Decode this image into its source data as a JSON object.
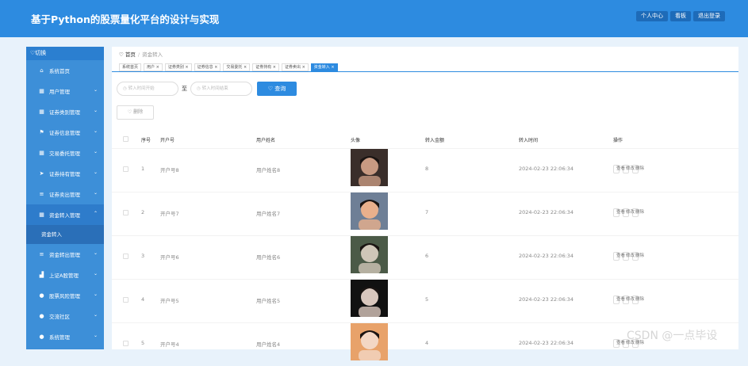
{
  "header": {
    "title": "基于Python的股票量化平台的设计与实现",
    "buttons": [
      "个人中心",
      "看板",
      "退出登录"
    ]
  },
  "sidebar": {
    "switch_label": "切换",
    "items": [
      {
        "label": "系统首页",
        "icon": "home-icon",
        "chevron": false
      },
      {
        "label": "用户管理",
        "icon": "grid-icon",
        "chevron": true
      },
      {
        "label": "证券类别管理",
        "icon": "grid-icon",
        "chevron": true
      },
      {
        "label": "证券信息管理",
        "icon": "flag-icon",
        "chevron": true
      },
      {
        "label": "交易委托管理",
        "icon": "grid-icon",
        "chevron": true
      },
      {
        "label": "证券持有管理",
        "icon": "send-icon",
        "chevron": true
      },
      {
        "label": "证券卖出管理",
        "icon": "list-icon",
        "chevron": true
      },
      {
        "label": "资金转入管理",
        "icon": "grid-icon",
        "chevron": true,
        "active": true
      },
      {
        "label": "资金转出管理",
        "icon": "list-icon",
        "chevron": true
      },
      {
        "label": "上证A股管理",
        "icon": "chart-icon",
        "chevron": true
      },
      {
        "label": "股票风险管理",
        "icon": "user-icon",
        "chevron": true
      },
      {
        "label": "交流社区",
        "icon": "pin-icon",
        "chevron": true
      },
      {
        "label": "系统管理",
        "icon": "user-icon",
        "chevron": true
      }
    ],
    "subitem": "资金转入"
  },
  "breadcrumb": {
    "home": "首页",
    "current": "资金转入"
  },
  "tabs": [
    "系统首页",
    "用户",
    "证券类别",
    "证券信息",
    "交易委托",
    "证券持有",
    "证券卖出",
    "资金转入"
  ],
  "search": {
    "start_placeholder": "转入时间开始",
    "to": "至",
    "end_placeholder": "转入时间结束",
    "button": "查询"
  },
  "delete_button": "删除",
  "table": {
    "headers": [
      "序号",
      "开户号",
      "用户姓名",
      "头像",
      "转入金额",
      "转入时间",
      "操作"
    ],
    "actions": [
      "查看",
      "修改",
      "删除"
    ],
    "rows": [
      {
        "no": "1",
        "account": "开户号8",
        "name": "用户姓名8",
        "amount": "8",
        "time": "2024-02-23 22:06:34"
      },
      {
        "no": "2",
        "account": "开户号7",
        "name": "用户姓名7",
        "amount": "7",
        "time": "2024-02-23 22:06:34"
      },
      {
        "no": "3",
        "account": "开户号6",
        "name": "用户姓名6",
        "amount": "6",
        "time": "2024-02-23 22:06:34"
      },
      {
        "no": "4",
        "account": "开户号5",
        "name": "用户姓名5",
        "amount": "5",
        "time": "2024-02-23 22:06:34"
      },
      {
        "no": "5",
        "account": "开户号4",
        "name": "用户姓名4",
        "amount": "4",
        "time": "2024-02-23 22:06:34"
      }
    ]
  },
  "watermark": "CSDN @一点毕设"
}
